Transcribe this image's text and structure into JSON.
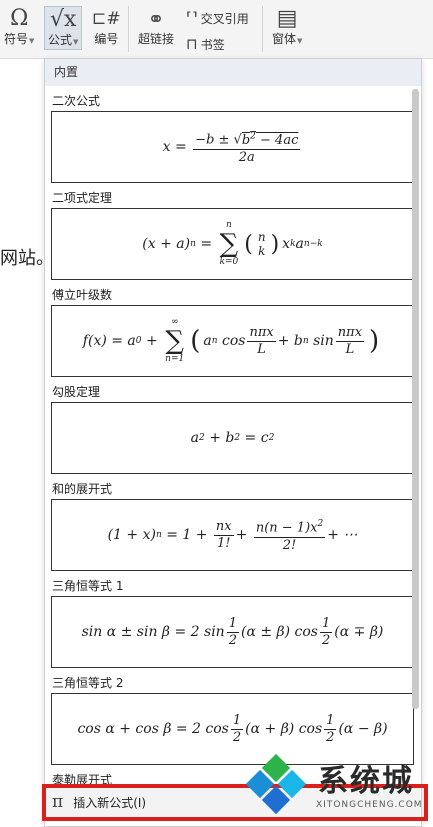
{
  "ribbon": {
    "symbol": {
      "icon": "Ω",
      "label": "符号"
    },
    "formula": {
      "icon": "√x",
      "label": "公式"
    },
    "numbering": {
      "icon": "⊏#",
      "label": "编号"
    },
    "hyperlink": {
      "icon": "⚭",
      "label": "超链接"
    },
    "cross_ref": {
      "icon": "⸢⸣",
      "label": "交叉引用"
    },
    "bookmark": {
      "icon": "⊓",
      "label": "书签"
    },
    "window": {
      "icon": "▤",
      "label": "窗体"
    }
  },
  "document": {
    "text_fragment": "网站。"
  },
  "panel": {
    "header": "内置",
    "sections": [
      {
        "title": "二次公式"
      },
      {
        "title": "二项式定理"
      },
      {
        "title": "傅立叶级数"
      },
      {
        "title": "勾股定理"
      },
      {
        "title": "和的展开式"
      },
      {
        "title": "三角恒等式 1"
      },
      {
        "title": "三角恒等式 2"
      },
      {
        "title": "泰勒展开式"
      }
    ],
    "insert_label": "插入新公式(I)",
    "insert_icon": "π"
  },
  "watermark": {
    "text": "系统城",
    "url": "XITONGCHENG.COM",
    "colors": [
      "#1a8fd6",
      "#2db34a",
      "#19b6e8",
      "#1f6fd1"
    ]
  },
  "colors": {
    "highlight": "#d9201c",
    "panel_header": "#e9eef5"
  }
}
